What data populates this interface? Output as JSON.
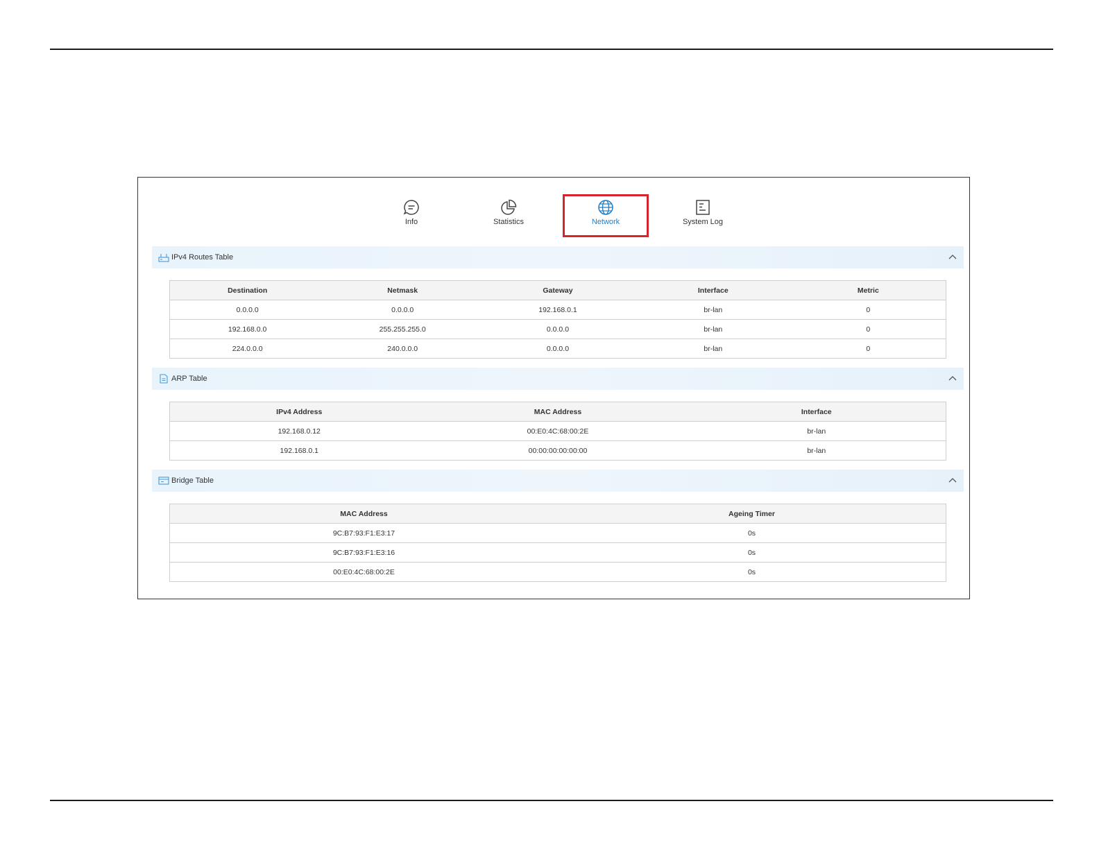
{
  "tabs": [
    {
      "label": "Info",
      "icon": "chat-bubble-icon"
    },
    {
      "label": "Statistics",
      "icon": "pie-chart-icon"
    },
    {
      "label": "Network",
      "icon": "globe-icon",
      "active": true
    },
    {
      "label": "System Log",
      "icon": "document-icon"
    }
  ],
  "highlight_color": "#d6232c",
  "accent_color": "#1f7fc4",
  "ipv4_routes": {
    "title": "IPv4 Routes Table",
    "icon": "router-icon",
    "columns": [
      "Destination",
      "Netmask",
      "Gateway",
      "Interface",
      "Metric"
    ],
    "rows": [
      [
        "0.0.0.0",
        "0.0.0.0",
        "192.168.0.1",
        "br-lan",
        "0"
      ],
      [
        "192.168.0.0",
        "255.255.255.0",
        "0.0.0.0",
        "br-lan",
        "0"
      ],
      [
        "224.0.0.0",
        "240.0.0.0",
        "0.0.0.0",
        "br-lan",
        "0"
      ]
    ]
  },
  "arp": {
    "title": "ARP Table",
    "icon": "file-icon",
    "columns": [
      "IPv4 Address",
      "MAC Address",
      "Interface"
    ],
    "rows": [
      [
        "192.168.0.12",
        "00:E0:4C:68:00:2E",
        "br-lan"
      ],
      [
        "192.168.0.1",
        "00:00:00:00:00:00",
        "br-lan"
      ]
    ]
  },
  "bridge": {
    "title": "Bridge Table",
    "icon": "bridge-icon",
    "columns": [
      "MAC Address",
      "Ageing Timer"
    ],
    "rows": [
      [
        "9C:B7:93:F1:E3:17",
        "0s"
      ],
      [
        "9C:B7:93:F1:E3:16",
        "0s"
      ],
      [
        "00:E0:4C:68:00:2E",
        "0s"
      ]
    ]
  }
}
